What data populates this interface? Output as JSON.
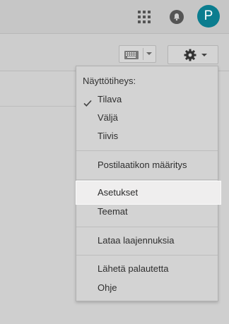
{
  "header": {
    "avatar_letter": "P",
    "apps_icon": "apps-grid-icon",
    "notification_icon": "bell-icon"
  },
  "toolbar": {
    "keyboard_icon": "keyboard-icon",
    "settings_icon": "gear-icon"
  },
  "menu": {
    "heading": "Näyttötiheys:",
    "density_options": [
      {
        "label": "Tilava",
        "checked": true
      },
      {
        "label": "Väljä",
        "checked": false
      },
      {
        "label": "Tiivis",
        "checked": false
      }
    ],
    "mailbox_setup": "Postilaatikon määritys",
    "settings": "Asetukset",
    "themes": "Teemat",
    "extensions": "Lataa laajennuksia",
    "feedback": "Lähetä palautetta",
    "help": "Ohje"
  },
  "colors": {
    "avatar_bg": "#0b7d8f",
    "highlight_bg": "#efeeee"
  }
}
